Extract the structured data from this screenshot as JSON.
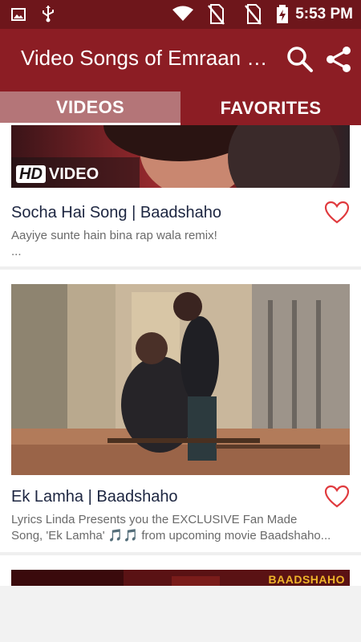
{
  "status_bar": {
    "time": "5:53 PM",
    "icons": [
      "image-icon",
      "usb-icon",
      "wifi-icon",
      "no-sim-icon",
      "no-sim-icon",
      "battery-charging-icon"
    ]
  },
  "app_bar": {
    "title": "Video Songs of Emraan Hashmi",
    "icons": [
      "search-icon",
      "share-icon"
    ]
  },
  "tabs": [
    {
      "label": "VIDEOS",
      "active": true
    },
    {
      "label": "FAVORITES",
      "active": false
    }
  ],
  "videos": [
    {
      "thumbnail_badge": "VIDEO",
      "thumbnail_badge_prefix": "HD",
      "title": "Socha Hai Song | Baadshaho",
      "description_lines": [
        "Aayiye sunte hain bina rap wala remix!",
        "..."
      ],
      "favorite_icon": "heart-outline-icon"
    },
    {
      "title": "Ek Lamha | Baadshaho",
      "description_lines": [
        "Lyrics Linda Presents you the EXCLUSIVE Fan Made",
        "Song, 'Ek Lamha' 🎵🎵 from upcoming movie Baadshaho..."
      ],
      "favorite_icon": "heart-outline-icon"
    },
    {
      "thumbnail_text": "BAADSHAHO"
    }
  ],
  "colors": {
    "status_bar": "#6e161b",
    "app_bar": "#8c1d24",
    "tab_active": "#b47578",
    "heart": "#e03a3e"
  }
}
